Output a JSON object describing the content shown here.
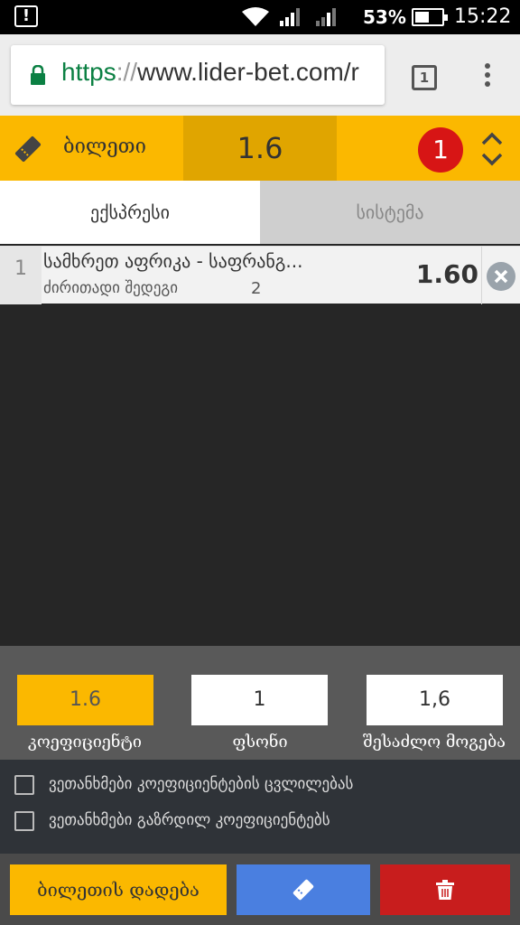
{
  "status_bar": {
    "battery": "53%",
    "battery_level": 0.53,
    "time": "15:22"
  },
  "browser": {
    "url_scheme": "https",
    "url_separator": "://",
    "url_host": "www.lider-bet.com/r",
    "tab_count": "1"
  },
  "ticket": {
    "title": "ბილეთი",
    "odds": "1.6",
    "selections_count": "1",
    "accent_color": "#fbb800",
    "tabs": {
      "express": "ექსპრესი",
      "system": "სისტემა"
    },
    "selections": [
      {
        "index": "1",
        "event": "სამხრეთ აფრიკა - საფრანგ...",
        "market": "ძირითადი შედეგი",
        "outcome": "2",
        "odds": "1.60"
      }
    ]
  },
  "totals": {
    "coefficient_value": "1.6",
    "coefficient_label": "კოეფიციენტი",
    "stake_value": "1",
    "stake_label": "ფსონი",
    "win_value": "1,6",
    "win_label": "შესაძლო მოგება"
  },
  "options": {
    "accept_changes": "ვეთანხმები კოეფიციენტების ცვლილებას",
    "accept_increased": "ვეთანხმები გაზრდილ კოეფიციენტებს"
  },
  "actions": {
    "place_bet": "ბილეთის დადება"
  },
  "icons": {
    "alert": "alert-icon",
    "wifi": "wifi-icon",
    "signal": "signal-icon",
    "lock": "lock-icon",
    "ticket": "ticket-icon",
    "collapse": "chevron-up-down-icon",
    "remove": "close-circle-icon",
    "share": "ticket-share-icon",
    "delete": "trash-icon"
  }
}
